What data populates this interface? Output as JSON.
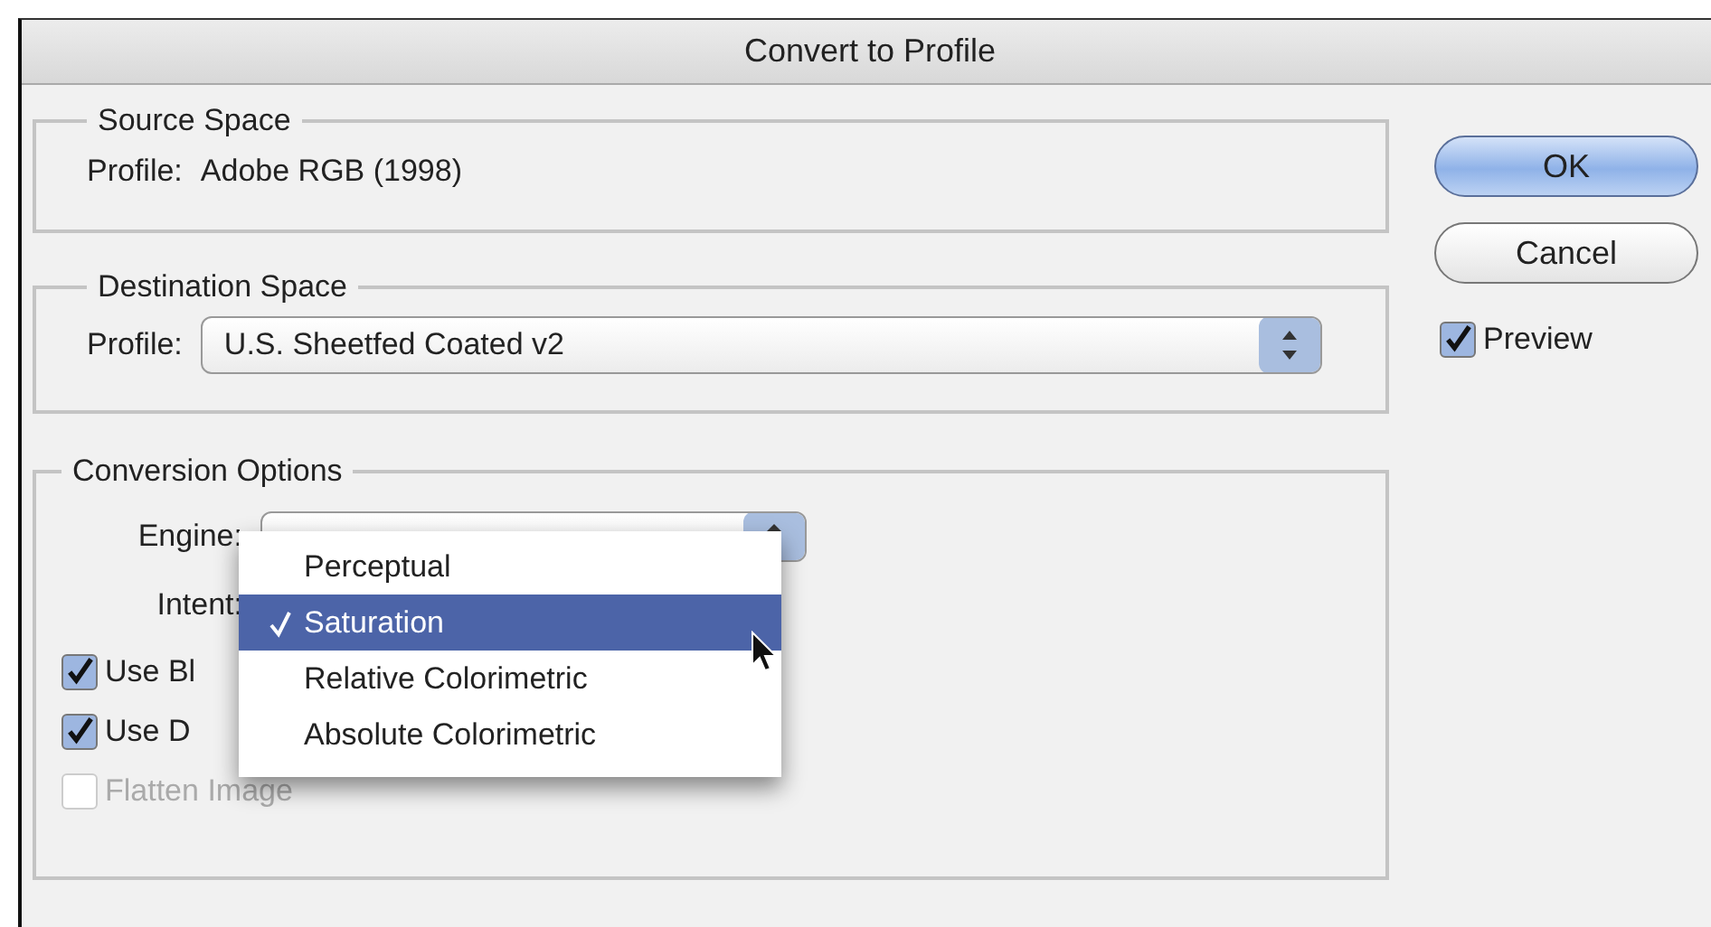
{
  "window": {
    "title": "Convert to Profile"
  },
  "source_space": {
    "title": "Source Space",
    "label": "Profile:",
    "value": "Adobe RGB (1998)"
  },
  "destination_space": {
    "title": "Destination Space",
    "label": "Profile:",
    "value": "U.S. Sheetfed Coated v2"
  },
  "conversion_options": {
    "title": "Conversion Options",
    "engine_label": "Engine:",
    "intent_label": "Intent:",
    "intent_menu": [
      {
        "label": "Perceptual",
        "selected": false
      },
      {
        "label": "Saturation",
        "selected": true
      },
      {
        "label": "Relative Colorimetric",
        "selected": false
      },
      {
        "label": "Absolute Colorimetric",
        "selected": false
      }
    ],
    "checkboxes": [
      {
        "label": "Use Bl",
        "checked": true,
        "disabled": false
      },
      {
        "label": "Use D",
        "checked": true,
        "disabled": false
      },
      {
        "label": "Flatten Image",
        "checked": false,
        "disabled": true
      }
    ]
  },
  "buttons": [
    {
      "label": "OK",
      "default": true
    },
    {
      "label": "Cancel",
      "default": false
    }
  ],
  "preview": {
    "label": "Preview",
    "checked": true
  }
}
